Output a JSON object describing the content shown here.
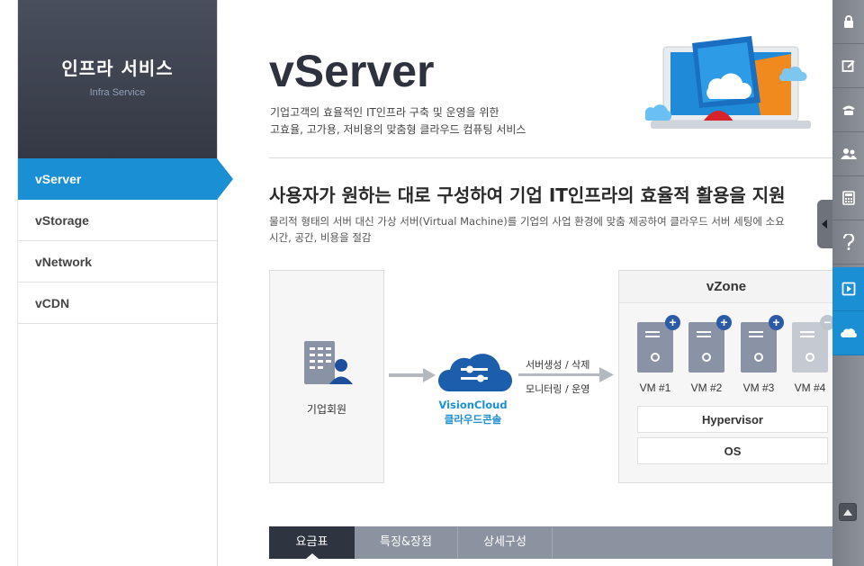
{
  "sidebar": {
    "title": "인프라 서비스",
    "subtitle": "Infra Service",
    "items": [
      {
        "label": "vServer",
        "active": true
      },
      {
        "label": "vStorage",
        "active": false
      },
      {
        "label": "vNetwork",
        "active": false
      },
      {
        "label": "vCDN",
        "active": false
      }
    ]
  },
  "main": {
    "title": "vServer",
    "desc_line1": "기업고객의 효율적인 IT인프라 구축 및 운영을 위한",
    "desc_line2": "고효율, 고가용, 저비용의 맞춤형 클라우드 컴퓨팅 서비스",
    "headline": "사용자가 원하는 대로 구성하여 기업 IT인프라의 효율적 활용을 지원",
    "body_line1": "물리적 형태의 서버 대신 가상 서버(Virtual Machine)를 기업의 사업 환경에 맞춤 제공하여 클라우드 서버 세팅에 소요",
    "body_line2": "시간, 공간, 비용을 절감"
  },
  "diagram": {
    "member_label": "기업회원",
    "console_name": "VisionCloud",
    "console_sub": "클라우드콘솔",
    "arrow_top": "서버생성 / 삭제",
    "arrow_bottom": "모니터링 / 운영",
    "zone_title": "vZone",
    "vms": [
      {
        "label": "VM #1",
        "badge": "+"
      },
      {
        "label": "VM #2",
        "badge": "+"
      },
      {
        "label": "VM #3",
        "badge": "+"
      },
      {
        "label": "VM #4",
        "badge": "−"
      }
    ],
    "layer1": "Hypervisor",
    "layer2": "OS"
  },
  "tabs": [
    {
      "label": "요금표",
      "active": true
    },
    {
      "label": "특징&장점",
      "active": false
    },
    {
      "label": "상세구성",
      "active": false
    }
  ],
  "toolbar": {
    "items": [
      "lock-icon",
      "edit-icon",
      "phone-icon",
      "users-icon",
      "calculator-icon",
      "help-icon",
      "presentation-icon",
      "cloud-icon"
    ],
    "active_item": "presentation-icon"
  },
  "colors": {
    "accent": "#1a8fd4",
    "sidebar_header": "#3d424e",
    "tab_active": "#2e3440",
    "tab_bar": "#8b93a1",
    "vm_server": "#8a93a5",
    "vm_badge": "#2a5aa8"
  }
}
